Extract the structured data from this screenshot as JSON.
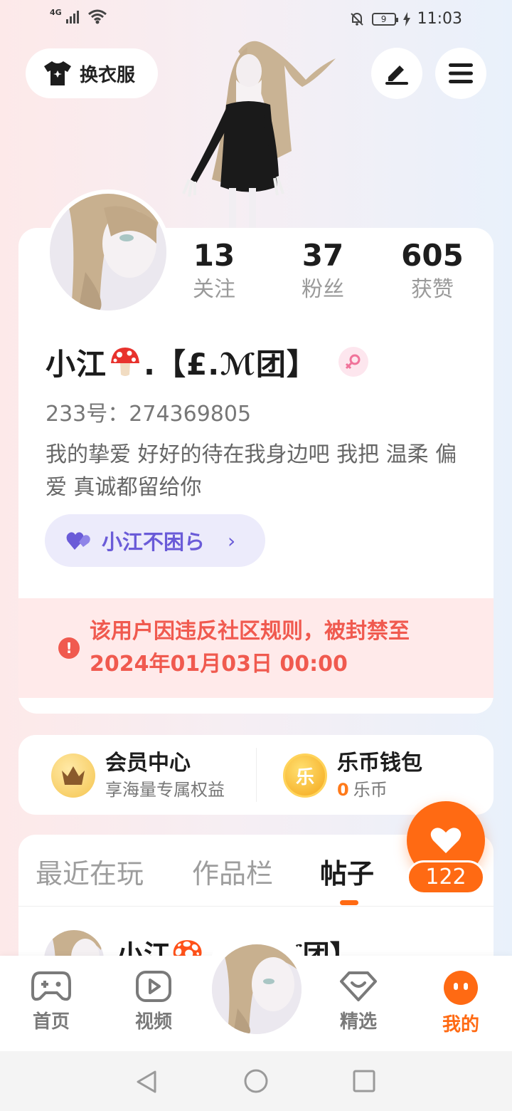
{
  "status_bar": {
    "network": "4G",
    "battery": "9",
    "time": "11:03"
  },
  "top_bar": {
    "dress_label": "换衣服"
  },
  "profile": {
    "stats": [
      {
        "value": "13",
        "label": "关注"
      },
      {
        "value": "37",
        "label": "粉丝"
      },
      {
        "value": "605",
        "label": "获赞"
      }
    ],
    "name_prefix": "小江",
    "name_suffix": ".【£.ℳ团】",
    "uid_label": "233号：",
    "uid": "274369805",
    "bio": "我的挚爱 好好的待在我身边吧 我把 温柔 偏爱 真诚都留给你",
    "fan_chip_label": "小江不困ら",
    "ban_notice": "该用户因违反社区规则，被封禁至2024年01月03日 00:00"
  },
  "vip": {
    "title": "会员中心",
    "subtitle": "享海量专属权益"
  },
  "wallet": {
    "title": "乐币钱包",
    "coin_glyph": "乐",
    "amount": "0",
    "unit": "乐币"
  },
  "like": {
    "count": "122"
  },
  "tabs": [
    {
      "label": "最近在玩"
    },
    {
      "label": "作品栏"
    },
    {
      "label": "帖子"
    }
  ],
  "post_preview": {
    "author": "小江🍄.【£.ℳ团】"
  },
  "bottom_nav": [
    {
      "label": "首页"
    },
    {
      "label": "视频"
    },
    {
      "label": "精选"
    },
    {
      "label": "我的"
    }
  ],
  "colors": {
    "accent": "#ff6a13",
    "ban_red": "#f05a4f",
    "fan_purple": "#6a5bd8"
  }
}
